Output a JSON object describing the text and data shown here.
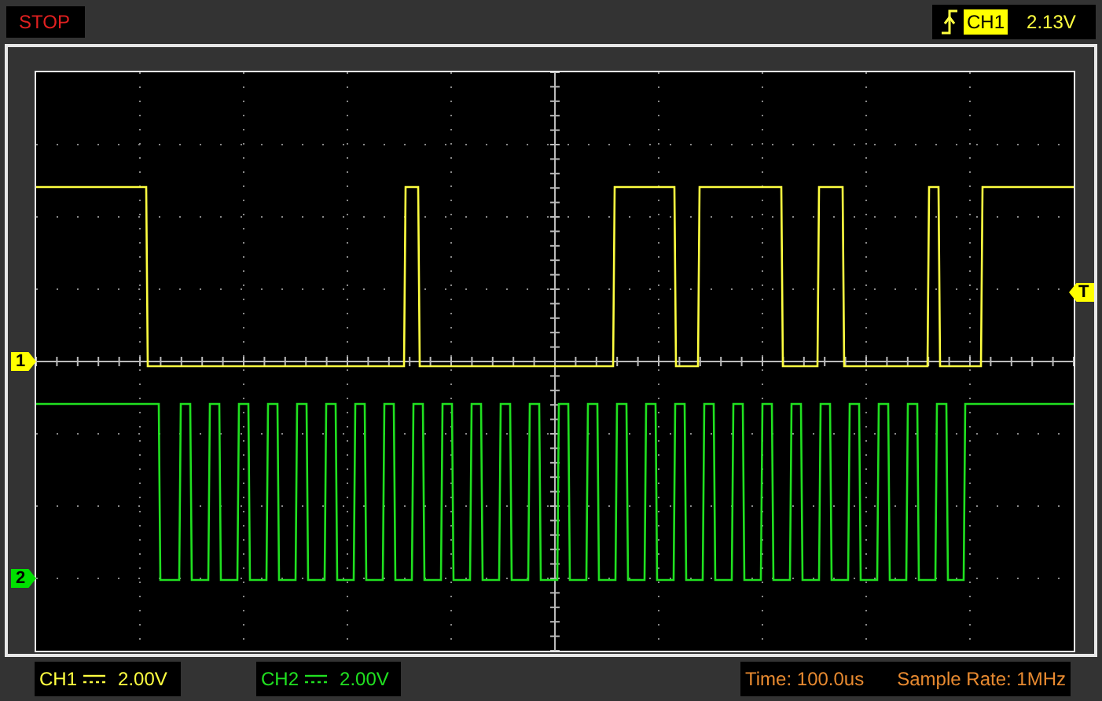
{
  "status": "STOP",
  "trigger": {
    "channel": "CH1",
    "level": "2.13V"
  },
  "markers": [
    {
      "label": "1",
      "color": "#ffff00"
    },
    {
      "label": "2",
      "color": "#00e000"
    }
  ],
  "trigger_marker": {
    "label": "T",
    "color": "#ffff00"
  },
  "channels": [
    {
      "name": "CH1",
      "scale": "2.00V",
      "color": "#ffff40"
    },
    {
      "name": "CH2",
      "scale": "2.00V",
      "color": "#20e020"
    }
  ],
  "time": "Time: 100.0us",
  "sample_rate": "Sample Rate: 1MHz"
}
